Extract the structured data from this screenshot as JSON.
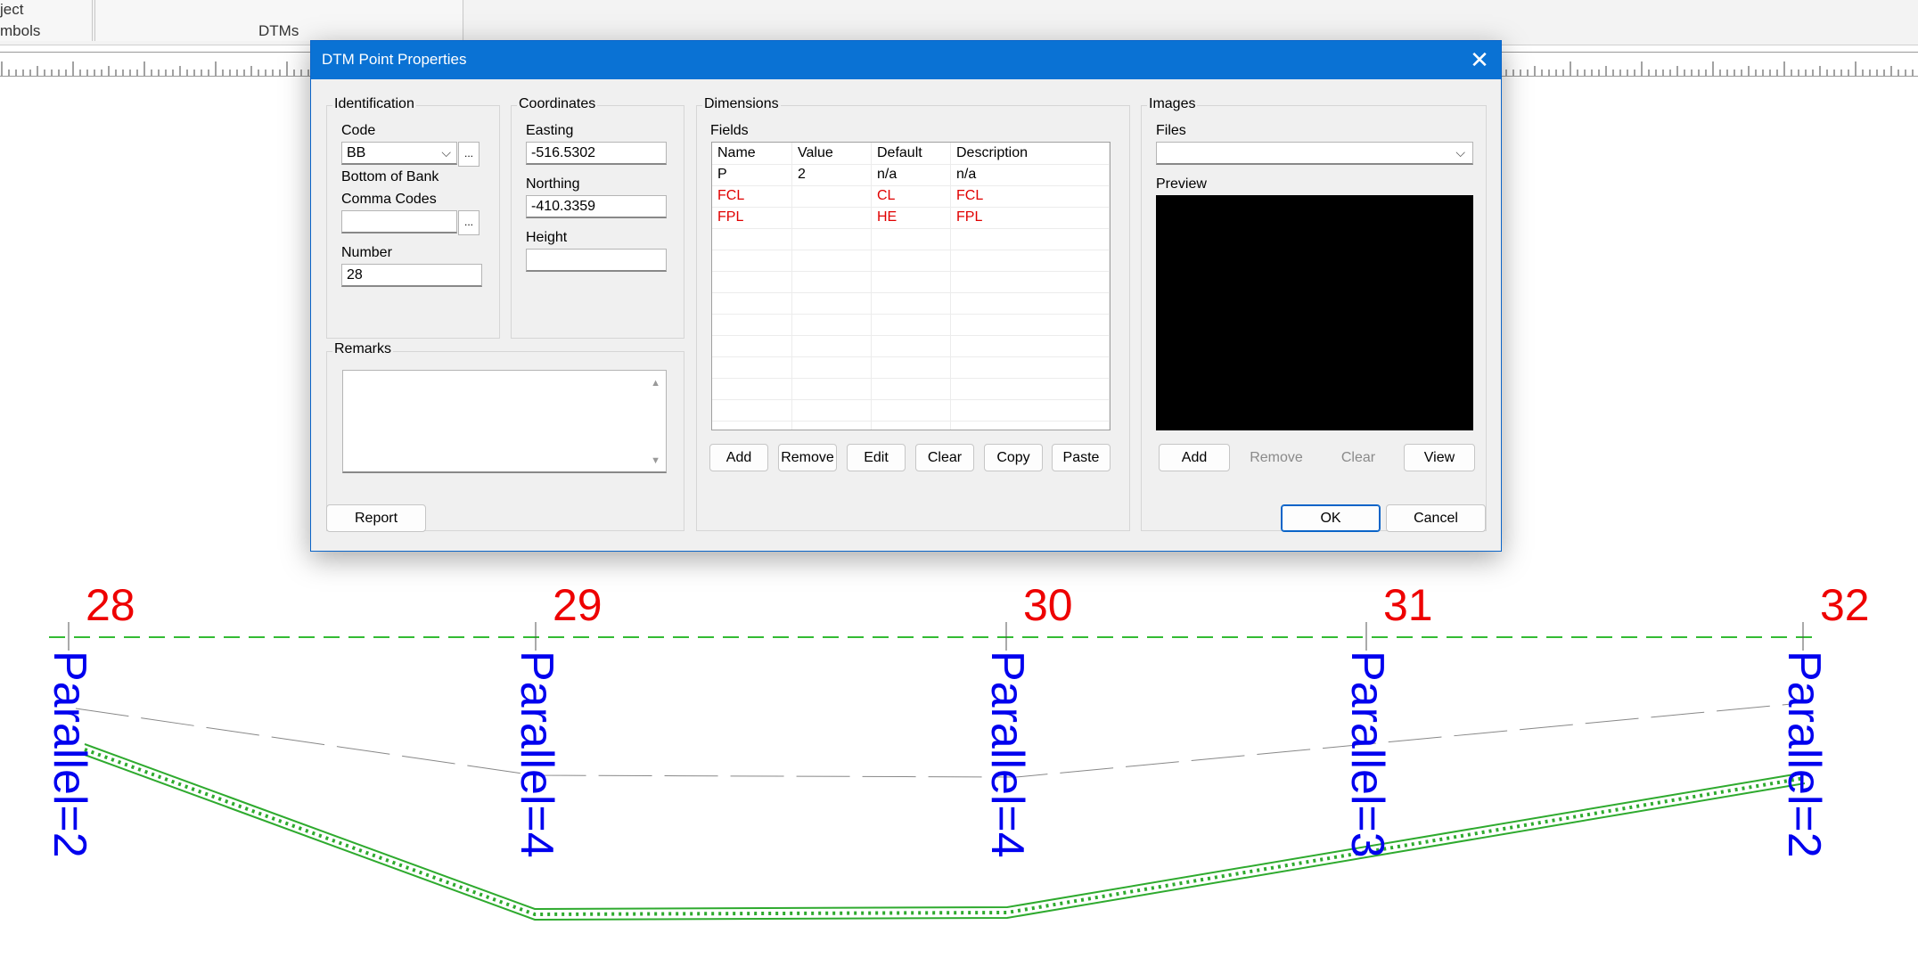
{
  "background": {
    "ribbon_labels": [
      "ject",
      "mbols",
      "DTMs"
    ],
    "point_numbers": [
      "28",
      "29",
      "30",
      "31",
      "32"
    ],
    "parallel_labels": [
      "Parallel=2",
      "Parallel=4",
      "Parallel=4",
      "Parallel=3",
      "Parallel=2"
    ]
  },
  "dialog": {
    "title": "DTM Point Properties",
    "close_glyph": "✕",
    "identification": {
      "title": "Identification",
      "code_label": "Code",
      "code_value": "BB",
      "code_desc": "Bottom of Bank",
      "comma_codes_label": "Comma Codes",
      "comma_codes_value": "",
      "number_label": "Number",
      "number_value": "28",
      "ellipsis": "..."
    },
    "coordinates": {
      "title": "Coordinates",
      "easting_label": "Easting",
      "easting_value": "-516.5302",
      "northing_label": "Northing",
      "northing_value": "-410.3359",
      "height_label": "Height",
      "height_value": ""
    },
    "remarks": {
      "title": "Remarks",
      "value": ""
    },
    "dimensions": {
      "title": "Dimensions",
      "fields_label": "Fields",
      "columns": [
        "Name",
        "Value",
        "Default",
        "Description"
      ],
      "rows": [
        {
          "name": "P",
          "value": "2",
          "default": "n/a",
          "description": "n/a",
          "color": "black"
        },
        {
          "name": "FCL",
          "value": "",
          "default": "CL",
          "description": "FCL",
          "color": "red"
        },
        {
          "name": "FPL",
          "value": "",
          "default": "HE",
          "description": "FPL",
          "color": "red"
        }
      ],
      "buttons": [
        "Add",
        "Remove",
        "Edit",
        "Clear",
        "Copy",
        "Paste"
      ]
    },
    "images": {
      "title": "Images",
      "files_label": "Files",
      "files_value": "",
      "preview_label": "Preview",
      "buttons": {
        "add": "Add",
        "remove": "Remove",
        "clear": "Clear",
        "view": "View"
      }
    },
    "footer": {
      "report": "Report",
      "ok": "OK",
      "cancel": "Cancel"
    }
  },
  "colors": {
    "title_bar": "#0a72d4",
    "point_number": "#ee0000",
    "parallel_label": "#0000ee",
    "surface_line": "#2eaa2e",
    "error_text": "#e00000"
  }
}
